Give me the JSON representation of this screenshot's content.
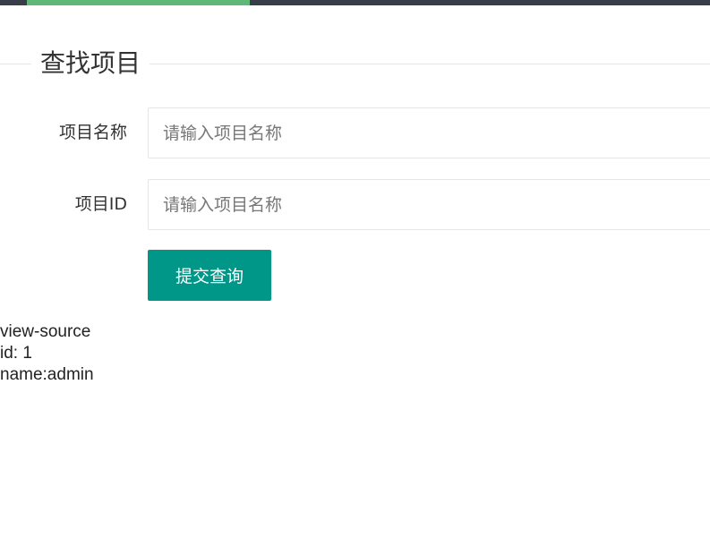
{
  "header": {
    "accent_color": "#5FB878",
    "bar_color": "#393D49"
  },
  "fieldset": {
    "title": "查找项目"
  },
  "form": {
    "project_name": {
      "label": "项目名称",
      "placeholder": "请输入项目名称",
      "value": ""
    },
    "project_id": {
      "label": "项目ID",
      "placeholder": "请输入项目名称",
      "value": ""
    },
    "submit_label": "提交查询",
    "submit_color": "#009688"
  },
  "output": {
    "line1": "view-source",
    "line2": "id: 1",
    "line3": "name:admin"
  }
}
